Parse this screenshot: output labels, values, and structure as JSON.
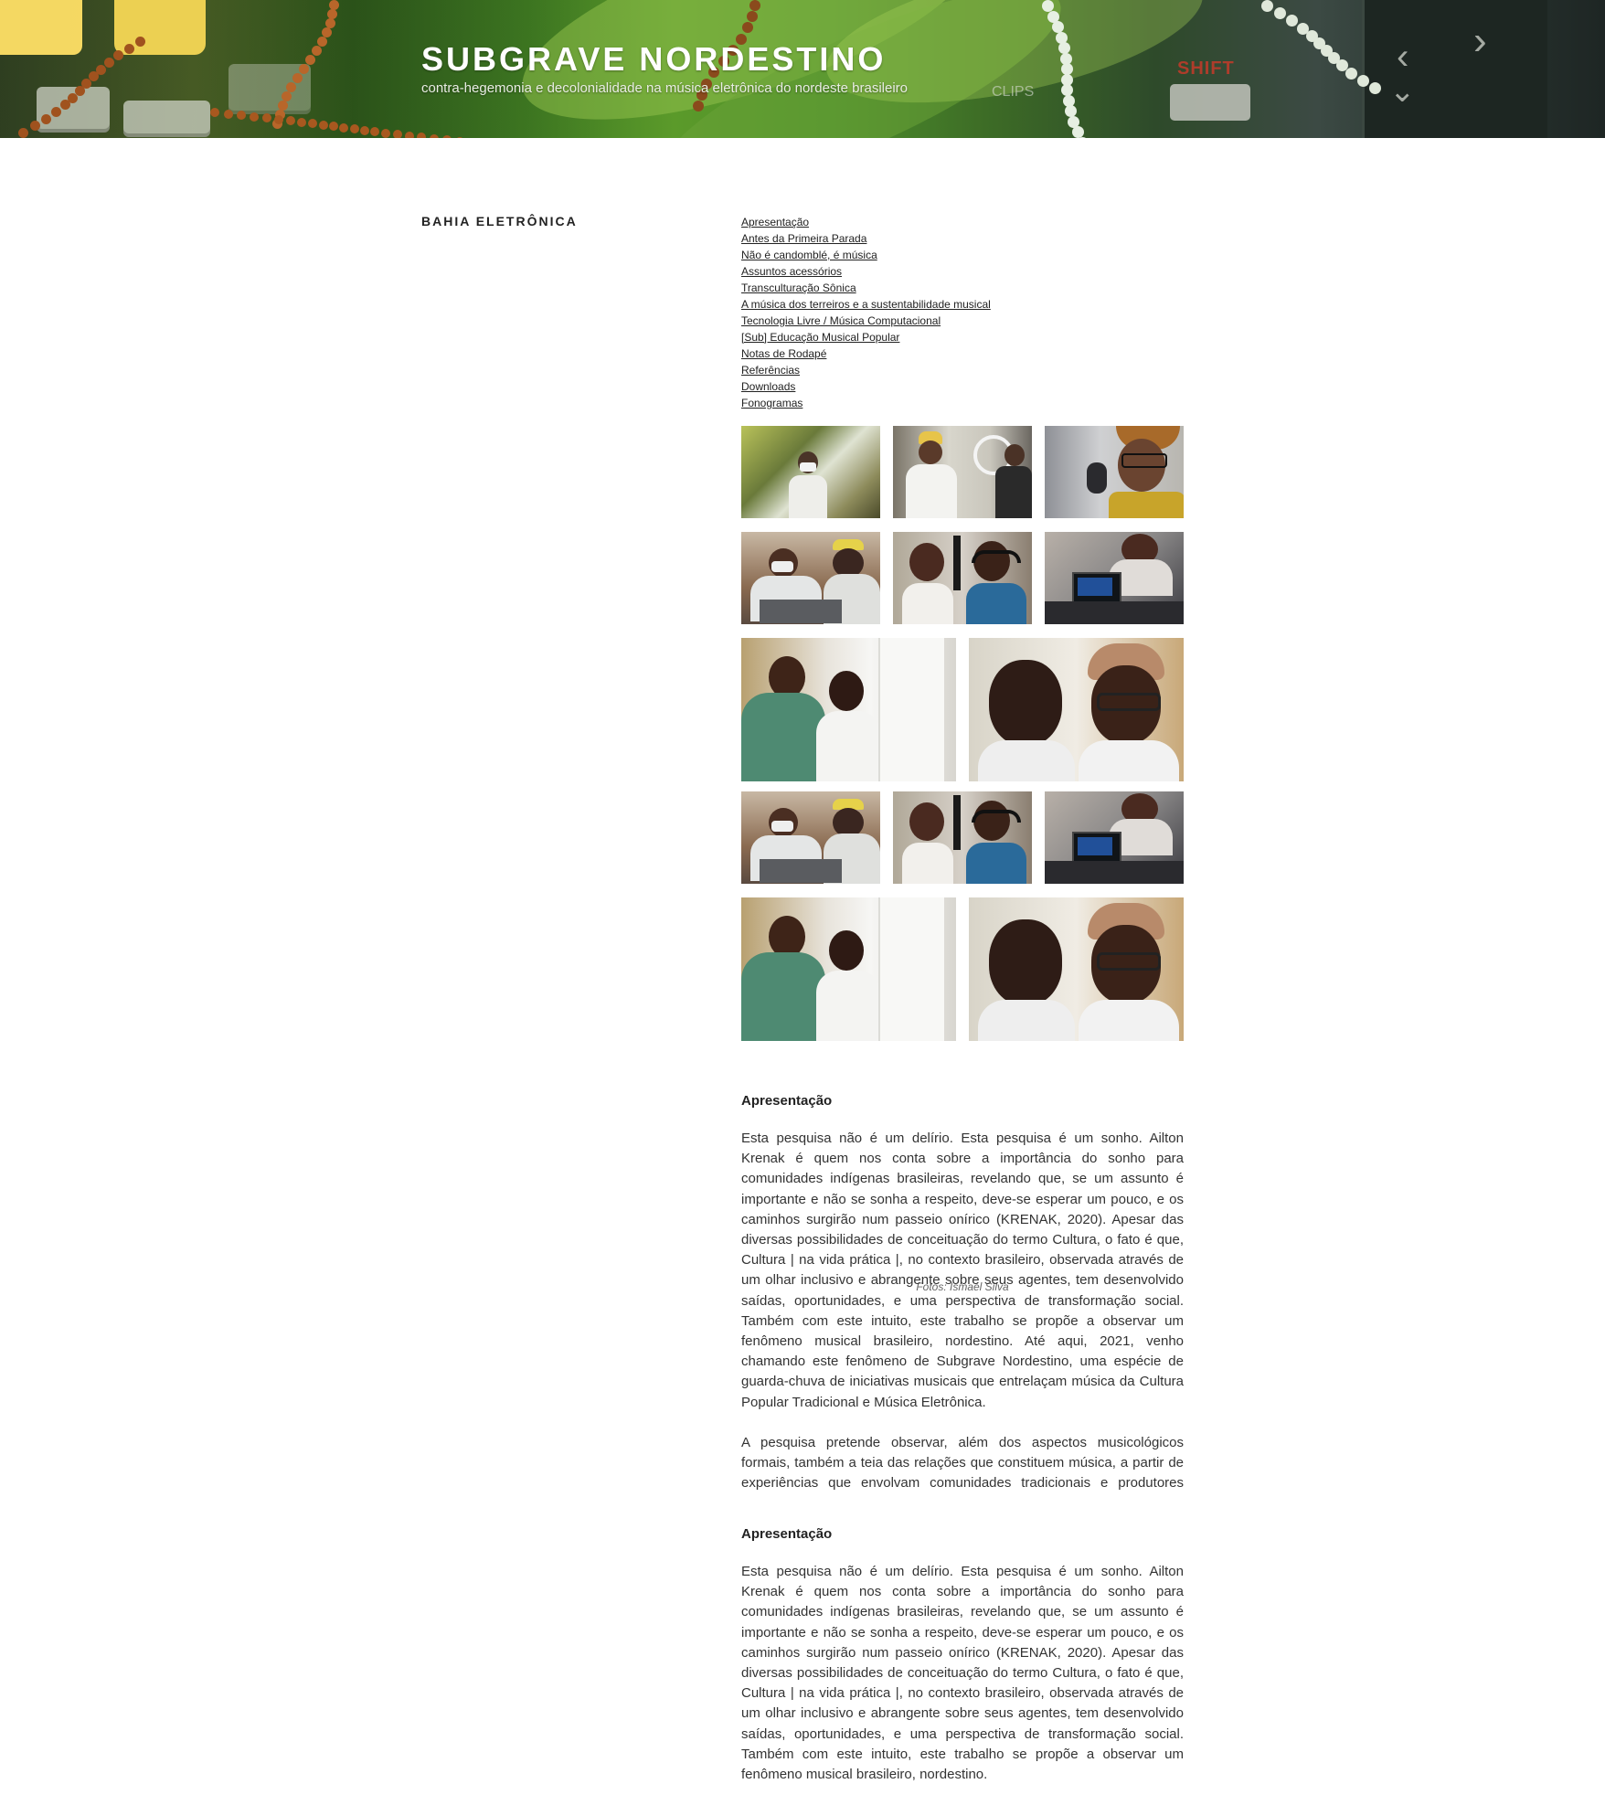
{
  "header": {
    "site_title": "SUBGRAVE NORDESTINO",
    "site_description": "contra-hegemonia e decolonialidade na música eletrônica do nordeste brasileiro",
    "shift_key_label": "SHIFT",
    "clips_label": "CLIPS"
  },
  "page": {
    "title": "BAHIA ELETRÔNICA"
  },
  "toc": [
    "Apresentação",
    "Antes da Primeira Parada",
    "Não é candomblé, é música",
    "Assuntos acessórios",
    "Transculturação Sônica",
    "A música dos terreiros e a sustentabilidade musical",
    "Tecnologia Livre / Música Computacional",
    "[Sub] Educação Musical Popular",
    "Notas de Rodapé",
    "Referências",
    "Downloads",
    "Fonogramas"
  ],
  "gallery": {
    "caption": "Fotos: Ismael Silva"
  },
  "sections": [
    {
      "heading": "Apresentação",
      "paragraphs": [
        "Esta pesquisa não é um delírio. Esta pesquisa é um sonho. Ailton Krenak é quem nos conta sobre a importância do sonho para comunidades indígenas brasileiras, revelando que, se um assunto é importante e não se sonha a respeito, deve-se esperar um pouco, e os caminhos surgirão num passeio onírico (KRENAK, 2020). Apesar das diversas possibilidades de conceituação do termo Cultura, o fato é que, Cultura | na vida prática |, no contexto brasileiro, observada através de um olhar inclusivo e abrangente sobre seus agentes, tem desenvolvido saídas, oportunidades, e uma perspectiva de transformação social. Também com este intuito, este trabalho se propõe a observar um fenômeno musical brasileiro, nordestino. Até aqui, 2021, venho chamando este fenômeno de Subgrave Nordestino, uma espécie de guarda-chuva de iniciativas musicais que entrelaçam música da Cultura Popular Tradicional e Música Eletrônica.",
        "A pesquisa pretende observar, além dos aspectos musicológicos formais, também a teia das relações que constituem música, a partir de experiências que envolvam comunidades tradicionais e produtores produtoras da música eletrônica nordestina, ou seja, o contexto de"
      ]
    },
    {
      "heading": "Apresentação",
      "paragraphs": [
        "Esta pesquisa não é um delírio. Esta pesquisa é um sonho. Ailton Krenak é quem nos conta sobre a importância do sonho para comunidades indígenas brasileiras, revelando que, se um assunto é importante e não se sonha a respeito, deve-se esperar um pouco, e os caminhos surgirão num passeio onírico (KRENAK, 2020). Apesar das diversas possibilidades de conceituação do termo Cultura, o fato é que, Cultura | na vida prática |, no contexto brasileiro, observada através de um olhar inclusivo e abrangente sobre seus agentes, tem desenvolvido saídas, oportunidades, e uma perspectiva de transformação social. Também com este intuito, este trabalho se propõe a observar um fenômeno musical brasileiro, nordestino."
      ]
    }
  ]
}
